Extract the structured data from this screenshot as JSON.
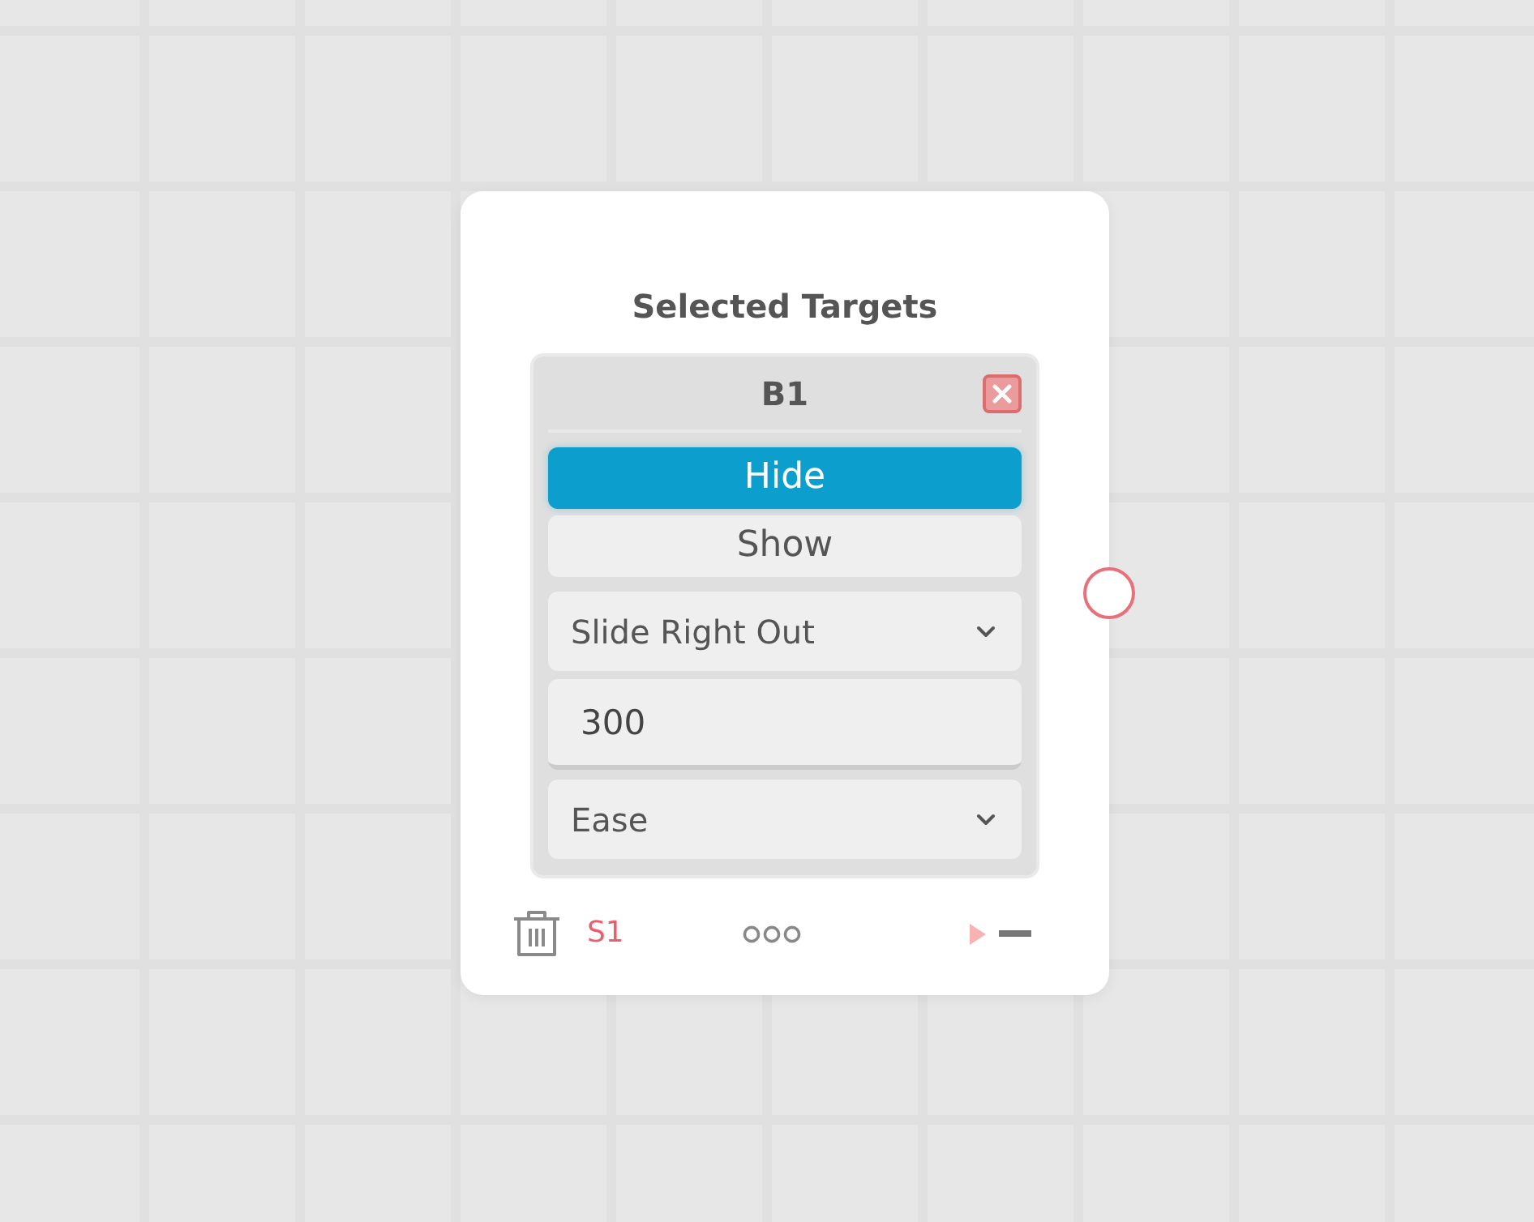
{
  "node": {
    "title": "Selected Targets",
    "target": {
      "name": "B1"
    },
    "visibility_options": [
      {
        "label": "Hide",
        "selected": true
      },
      {
        "label": "Show",
        "selected": false
      }
    ],
    "animation": {
      "value": "Slide Right Out"
    },
    "duration": {
      "value": "300"
    },
    "easing": {
      "value": "Ease"
    },
    "footer": {
      "label": "S1"
    }
  }
}
